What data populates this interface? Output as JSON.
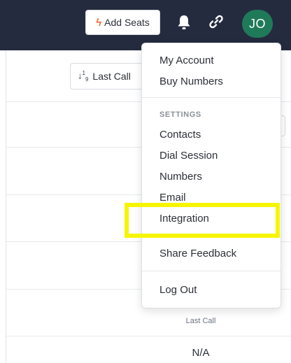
{
  "header": {
    "add_seats_label": "Add Seats",
    "avatar_initials": "JO",
    "icons": [
      "bolt-icon",
      "bell-icon",
      "link-icon"
    ]
  },
  "toolbar": {
    "sort_label": "Last Call"
  },
  "table": {
    "column_label": "Last Call",
    "first_value": "N/A"
  },
  "menu": {
    "items_top": [
      "My Account",
      "Buy Numbers"
    ],
    "settings_label": "SETTINGS",
    "settings_items": [
      "Contacts",
      "Dial Session",
      "Numbers",
      "Email",
      "Integration"
    ],
    "feedback": "Share Feedback",
    "logout": "Log Out"
  },
  "colors": {
    "navbar": "#252b3f",
    "avatar": "#1f7a5a",
    "accent": "#f26b2a",
    "highlight": "#f6f500"
  }
}
